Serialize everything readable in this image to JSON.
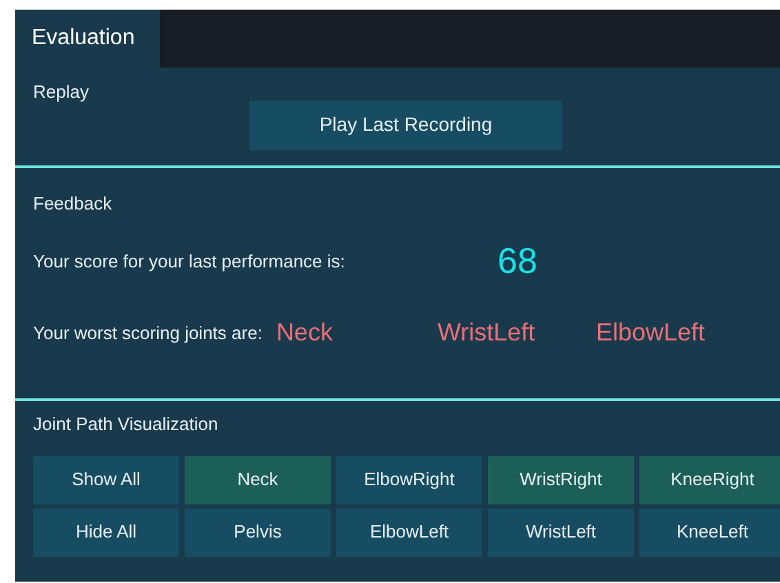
{
  "tabs": [
    {
      "label": "Evaluation",
      "selected": true
    }
  ],
  "replay": {
    "heading": "Replay",
    "button": "Play Last Recording"
  },
  "feedback": {
    "heading": "Feedback",
    "score_label": "Your score for your last performance is:",
    "score": "68",
    "worst_label": "Your worst scoring joints are:",
    "worst_joints": [
      "Neck",
      "WristLeft",
      "ElbowLeft"
    ]
  },
  "joint_path": {
    "heading": "Joint Path Visualization",
    "actions": [
      "Show All",
      "Hide All"
    ],
    "joints": [
      {
        "label": "Neck",
        "on": true
      },
      {
        "label": "Pelvis",
        "on": false
      },
      {
        "label": "ElbowRight",
        "on": false
      },
      {
        "label": "ElbowLeft",
        "on": false
      },
      {
        "label": "WristRight",
        "on": true
      },
      {
        "label": "WristLeft",
        "on": false
      },
      {
        "label": "KneeRight",
        "on": true
      },
      {
        "label": "KneeLeft",
        "on": false
      }
    ]
  }
}
